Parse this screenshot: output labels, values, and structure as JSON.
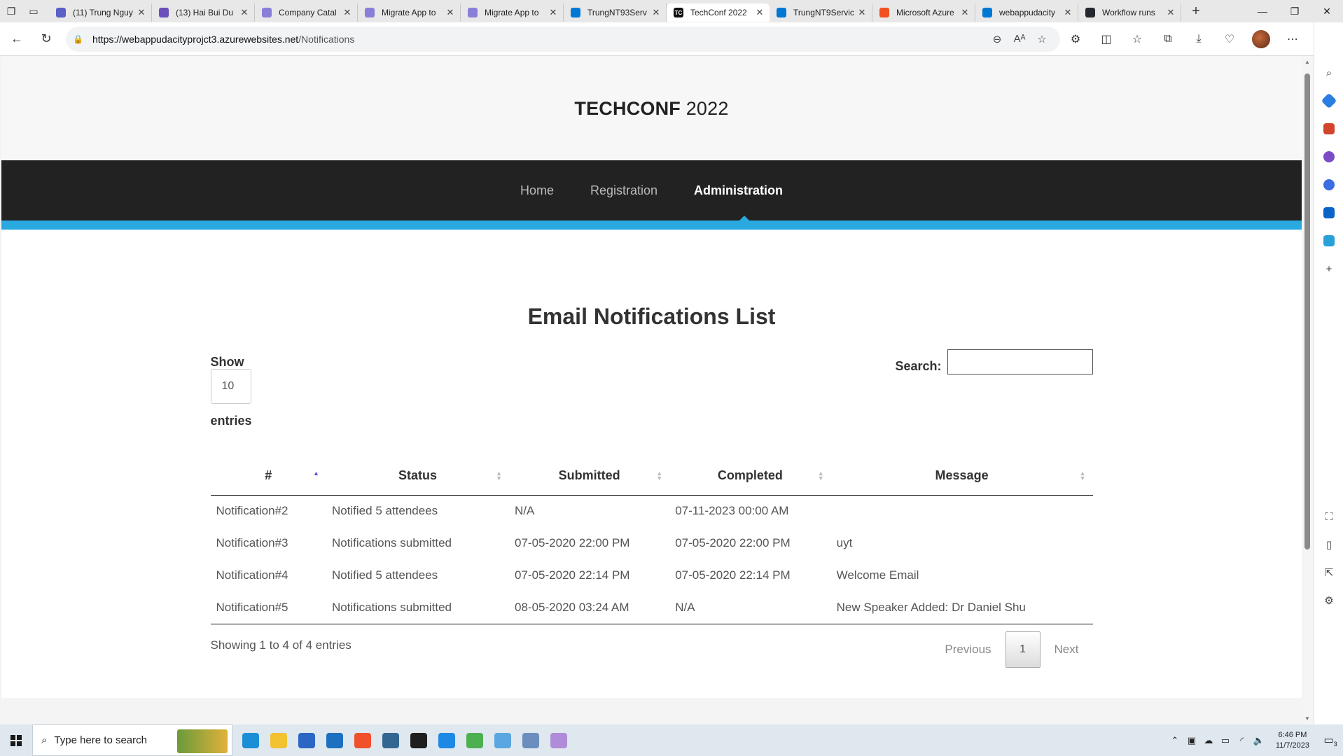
{
  "browser": {
    "tabs": [
      {
        "title": "(11) Trung Nguy",
        "favicon_color": "#5b5fc7",
        "active": false
      },
      {
        "title": "(13) Hai Bui Du",
        "favicon_color": "#6b4fbb",
        "active": false
      },
      {
        "title": "Company Catal",
        "favicon_color": "#8a7fd8",
        "active": false
      },
      {
        "title": "Migrate App to",
        "favicon_color": "#8a7fd8",
        "active": false
      },
      {
        "title": "Migrate App to",
        "favicon_color": "#8a7fd8",
        "active": false
      },
      {
        "title": "TrungNT93Serv",
        "favicon_color": "#0078d4",
        "active": false
      },
      {
        "title": "TechConf 2022",
        "favicon_color": "#111111",
        "favicon_text": "TC",
        "active": true
      },
      {
        "title": "TrungNT9Servic",
        "favicon_color": "#0078d4",
        "active": false
      },
      {
        "title": "Microsoft Azure",
        "favicon_color": "#f25022",
        "active": false
      },
      {
        "title": "webappudacity",
        "favicon_color": "#0078d4",
        "active": false
      },
      {
        "title": "Workflow runs",
        "favicon_color": "#24292f",
        "active": false
      }
    ],
    "url_domain": "https://webappudacityprojct3.azurewebsites.net",
    "url_path": "/Notifications"
  },
  "site": {
    "logo_strong": "TECHCONF",
    "logo_light": " 2022",
    "nav": [
      "Home",
      "Registration",
      "Administration"
    ],
    "active_nav": "Administration"
  },
  "main": {
    "title": "Email Notifications List",
    "show_label": "Show",
    "entries_label": "entries",
    "page_length": "10",
    "search_label": "Search:",
    "search_value": ""
  },
  "table": {
    "columns": [
      "#",
      "Status",
      "Submitted",
      "Completed",
      "Message"
    ],
    "sort_column": "#",
    "sort_direction": "asc",
    "rows": [
      {
        "id": "Notification#2",
        "status": "Notified 5 attendees",
        "submitted": "N/A",
        "completed": "07-11-2023 00:00 AM",
        "message": ""
      },
      {
        "id": "Notification#3",
        "status": "Notifications submitted",
        "submitted": "07-05-2020 22:00 PM",
        "completed": "07-05-2020 22:00 PM",
        "message": "uyt"
      },
      {
        "id": "Notification#4",
        "status": "Notified 5 attendees",
        "submitted": "07-05-2020 22:14 PM",
        "completed": "07-05-2020 22:14 PM",
        "message": "Welcome Email"
      },
      {
        "id": "Notification#5",
        "status": "Notifications submitted",
        "submitted": "08-05-2020 03:24 AM",
        "completed": "N/A",
        "message": "New Speaker Added: Dr Daniel Shu"
      }
    ]
  },
  "footer": {
    "info": "Showing 1 to 4 of 4 entries",
    "previous_label": "Previous",
    "current_page": "1",
    "next_label": "Next"
  },
  "taskbar": {
    "search_placeholder": "Type here to search",
    "time": "6:46 PM",
    "date": "11/7/2023",
    "notification_count": "3",
    "apps": [
      {
        "name": "edge-app-icon",
        "color": "#1b8fd6"
      },
      {
        "name": "file-explorer-icon",
        "color": "#f2c230"
      },
      {
        "name": "store-icon",
        "color": "#2b66c4"
      },
      {
        "name": "mail-icon",
        "color": "#1d6fc0"
      },
      {
        "name": "brave-icon",
        "color": "#f0502a"
      },
      {
        "name": "postgres-icon",
        "color": "#336791"
      },
      {
        "name": "terminal-icon",
        "color": "#1e1e1e"
      },
      {
        "name": "vscode-icon",
        "color": "#1e88e5"
      },
      {
        "name": "notepad-icon",
        "color": "#4caf50"
      },
      {
        "name": "azure-data-studio-icon",
        "color": "#5aa6e0"
      },
      {
        "name": "storage-explorer-icon",
        "color": "#6c8ebf"
      },
      {
        "name": "paint-icon",
        "color": "#b08cd8"
      }
    ]
  },
  "colors": {
    "accent": "#29a9e0",
    "navbar": "#222222",
    "sort_active": "#5a4fcf"
  }
}
